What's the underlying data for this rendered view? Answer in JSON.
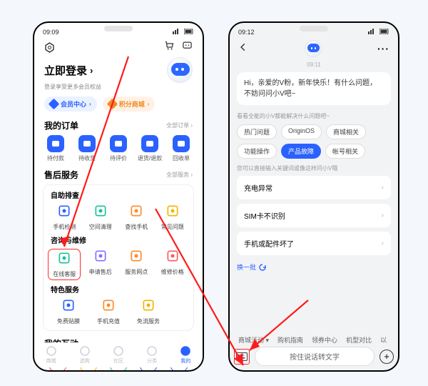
{
  "left": {
    "status_time": "09:09",
    "settings_icon": "settings",
    "cart_icon": "cart",
    "msg_icon": "message",
    "login_title": "立即登录",
    "login_sub": "登录享受更多会员权益",
    "avatar": "robot",
    "chips": {
      "member": "会员中心",
      "points": "积分商城"
    },
    "orders": {
      "title": "我的订单",
      "more": "全部订单 ›",
      "items": [
        {
          "label": "待付款",
          "color": "#2b62ff",
          "glyph": "card"
        },
        {
          "label": "待收货",
          "color": "#2b62ff",
          "glyph": "box"
        },
        {
          "label": "待评价",
          "color": "#2b62ff",
          "glyph": "chat"
        },
        {
          "label": "退货/退款",
          "color": "#2b62ff",
          "glyph": "refund"
        },
        {
          "label": "回收单",
          "color": "#2b62ff",
          "glyph": "recycle"
        }
      ]
    },
    "after": {
      "title": "售后服务",
      "more": "全部服务 ›",
      "group1_title": "自助排查",
      "group1": [
        {
          "label": "手机检测",
          "color": "#2b62ff"
        },
        {
          "label": "空间清理",
          "color": "#18c19a"
        },
        {
          "label": "查找手机",
          "color": "#ff8a2a"
        },
        {
          "label": "常见问题",
          "color": "#f2b400"
        }
      ],
      "group2_title": "咨询与维修",
      "group2": [
        {
          "label": "在线客服",
          "color": "#18c19a"
        },
        {
          "label": "申请售后",
          "color": "#8a6cff"
        },
        {
          "label": "服务网点",
          "color": "#ff8a2a"
        },
        {
          "label": "维修价格",
          "color": "#ff5a5a"
        }
      ],
      "group3_title": "特色服务",
      "group3": [
        {
          "label": "免费贴膜",
          "color": "#2b62ff"
        },
        {
          "label": "手机充值",
          "color": "#ff8a2a"
        },
        {
          "label": "免流服务",
          "color": "#f2b400"
        }
      ]
    },
    "hudong": {
      "title": "我的互动",
      "colors": [
        "#ff4d4d",
        "#ffb400",
        "#18c19a",
        "#2b62ff",
        "#2b62ff"
      ]
    },
    "tabs": [
      {
        "label": "商城",
        "active": false
      },
      {
        "label": "选购",
        "active": false
      },
      {
        "label": "社区",
        "active": false
      },
      {
        "label": "分类",
        "active": false
      },
      {
        "label": "我的",
        "active": true
      }
    ]
  },
  "right": {
    "status_time": "09:12",
    "timestamp": "09:11",
    "greeting": "Hi，亲爱的V粉，新年快乐！有什么问题，不妨问问小V吧~",
    "sug_title": "看看全能的小V都能解决什么问题吧~",
    "categories": [
      "热门问题",
      "OriginOS",
      "商城相关",
      "功能操作",
      "产品故障",
      "帐号相关"
    ],
    "active_category": "产品故障",
    "sug2": "您可以直接输入关键词或像这样问小V哦",
    "faqs": [
      "充电异常",
      "SIM卡不识别",
      "手机或配件坏了"
    ],
    "refresh": "换一批",
    "bottom_tabs": [
      "商城活动",
      "购机指南",
      "领券中心",
      "机型对比",
      "以"
    ],
    "input_placeholder": "按住说话转文字"
  }
}
